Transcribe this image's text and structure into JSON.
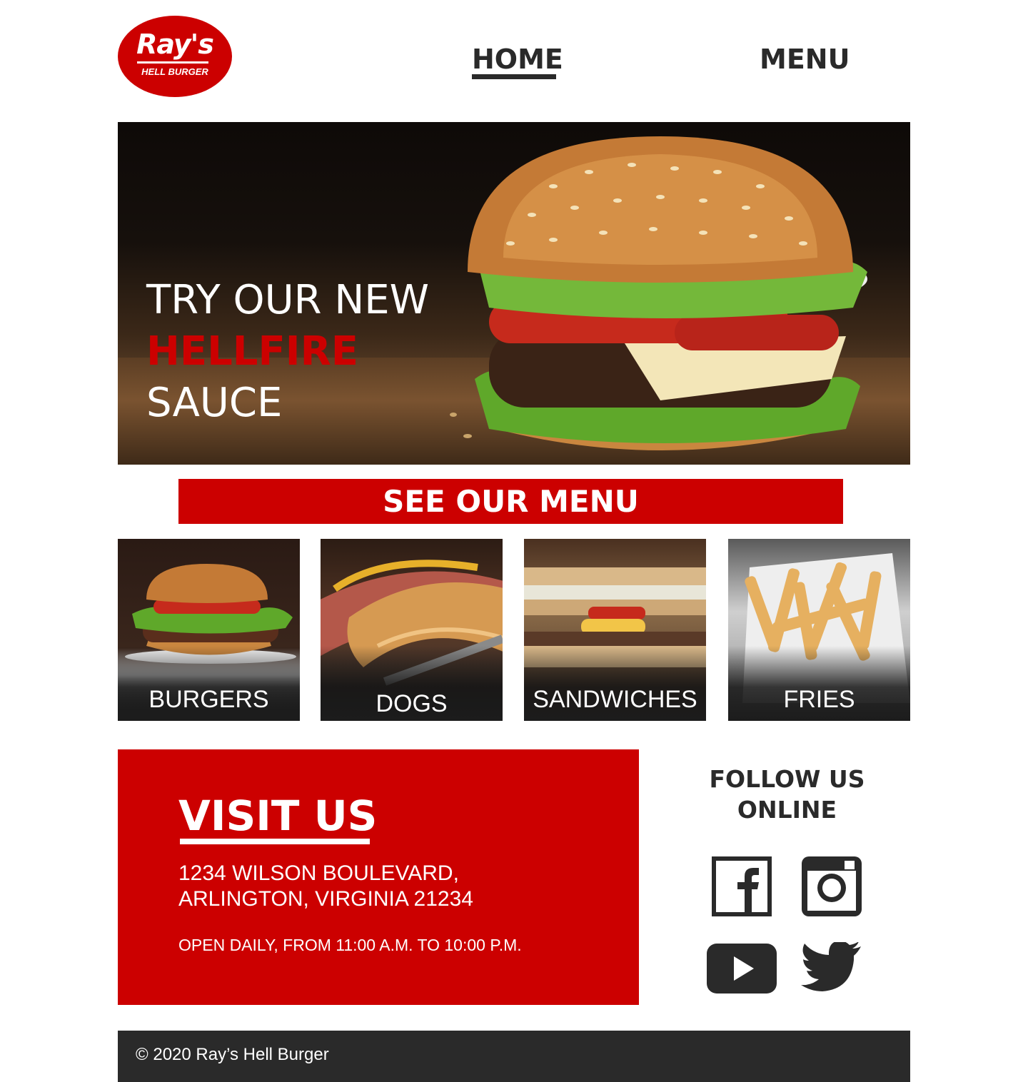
{
  "header": {
    "logo": {
      "main": "Ray's",
      "sub": "HELL BURGER"
    },
    "nav": [
      {
        "label": "HOME",
        "active": true
      },
      {
        "label": "MENU",
        "active": false
      }
    ]
  },
  "hero": {
    "line1": "TRY OUR NEW",
    "line2": "HELLFIRE",
    "line3": "SAUCE"
  },
  "menu_banner": {
    "label": "SEE OUR MENU"
  },
  "menu_tiles": [
    {
      "label": "BURGERS"
    },
    {
      "label": "DOGS"
    },
    {
      "label": "SANDWICHES"
    },
    {
      "label": "FRIES"
    }
  ],
  "visit": {
    "title": "VISIT US",
    "address_line1": "1234 WILSON BOULEVARD,",
    "address_line2": "ARLINGTON, VIRGINIA 21234",
    "hours": "OPEN DAILY, FROM 11:00 A.M. TO 10:00 P.M."
  },
  "follow": {
    "line1": "FOLLOW US",
    "line2": "ONLINE",
    "icons": [
      "facebook-icon",
      "instagram-icon",
      "youtube-icon",
      "twitter-icon"
    ]
  },
  "footer": {
    "copyright": "© 2020 Ray’s Hell Burger"
  },
  "colors": {
    "brand_red": "#cc0000",
    "dark": "#2a2a2a",
    "white": "#ffffff"
  }
}
